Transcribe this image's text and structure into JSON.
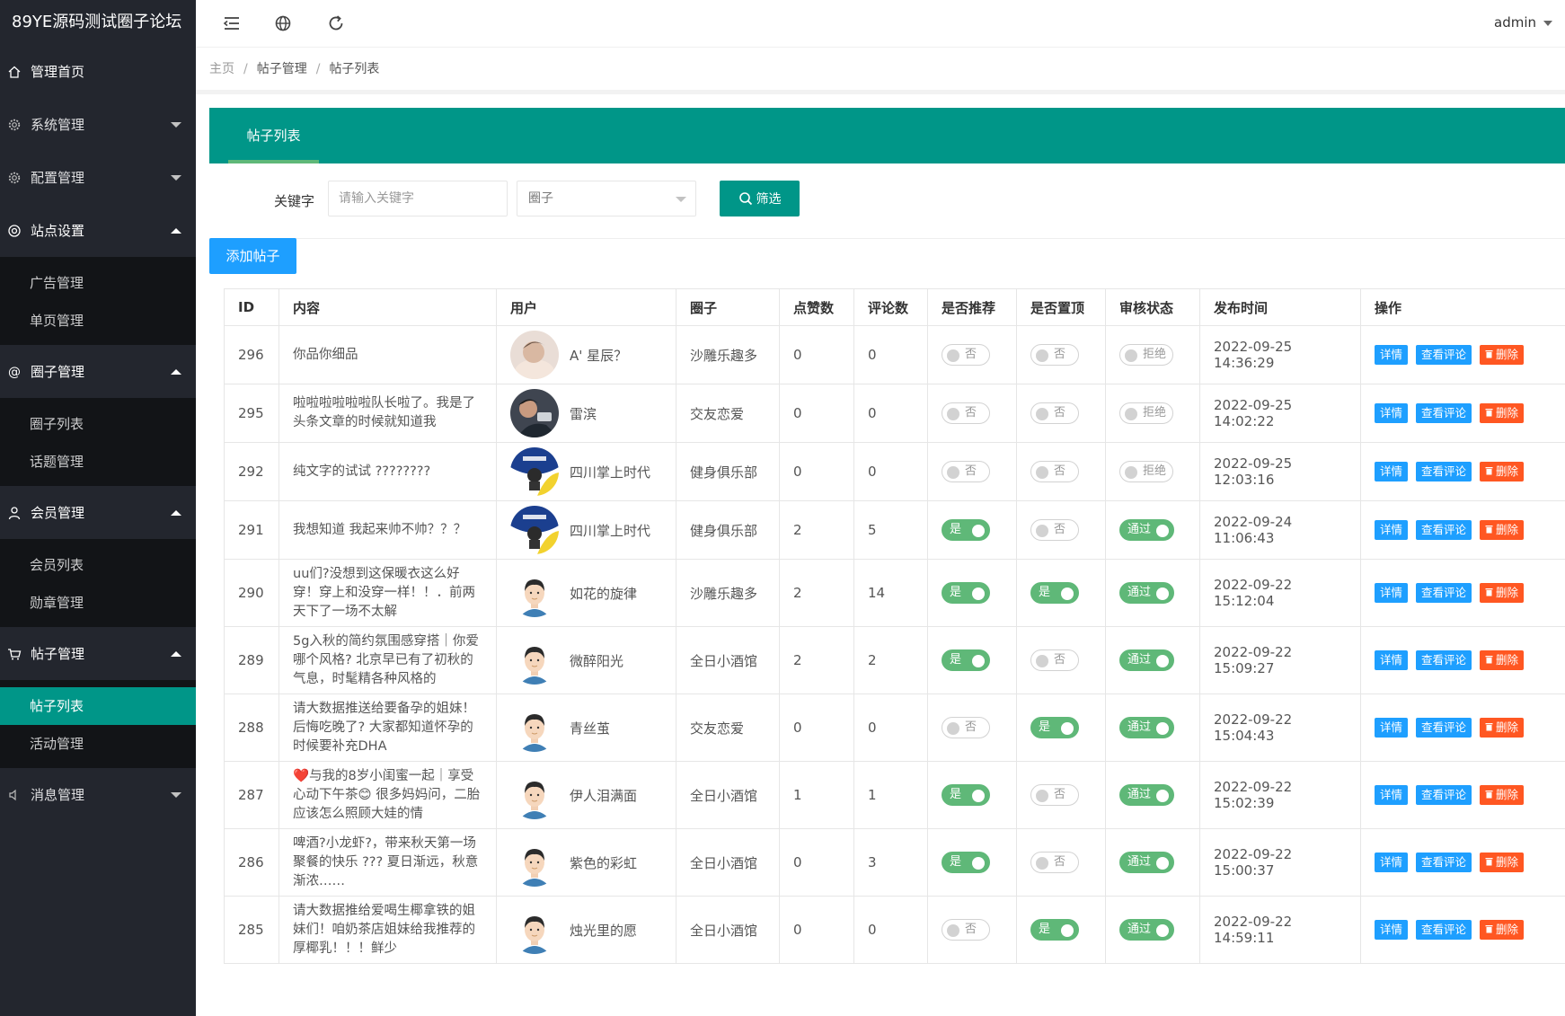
{
  "app": {
    "title": "89YE源码测试圈子论坛",
    "user": "admin"
  },
  "sidebar": {
    "items": [
      {
        "key": "home",
        "label": "管理首页",
        "icon": "home-icon",
        "arrow": ""
      },
      {
        "key": "system",
        "label": "系统管理",
        "icon": "gear-icon",
        "arrow": "down"
      },
      {
        "key": "config",
        "label": "配置管理",
        "icon": "gear-icon",
        "arrow": "down"
      },
      {
        "key": "site",
        "label": "站点设置",
        "icon": "target-icon",
        "arrow": "up",
        "children": [
          "广告管理",
          "单页管理"
        ]
      },
      {
        "key": "circle",
        "label": "圈子管理",
        "icon": "at-icon",
        "arrow": "up",
        "children": [
          "圈子列表",
          "话题管理"
        ]
      },
      {
        "key": "member",
        "label": "会员管理",
        "icon": "user-icon",
        "arrow": "up",
        "children": [
          "会员列表",
          "勋章管理"
        ]
      },
      {
        "key": "post",
        "label": "帖子管理",
        "icon": "cart-icon",
        "arrow": "up",
        "children": [
          "帖子列表",
          "活动管理"
        ],
        "active_child": 0
      },
      {
        "key": "message",
        "label": "消息管理",
        "icon": "speaker-icon",
        "arrow": "down"
      }
    ]
  },
  "header": {
    "icons": [
      "menu-fold-icon",
      "globe-icon",
      "refresh-icon"
    ]
  },
  "breadcrumb": [
    "主页",
    "帖子管理",
    "帖子列表"
  ],
  "tab": {
    "label": "帖子列表"
  },
  "filter": {
    "keyword_label": "关键字",
    "keyword_placeholder": "请输入关键字",
    "circle_placeholder": "圈子",
    "search_label": "筛选"
  },
  "add_button": "添加帖子",
  "table": {
    "headers": [
      "ID",
      "内容",
      "用户",
      "圈子",
      "点赞数",
      "评论数",
      "是否推荐",
      "是否置顶",
      "审核状态",
      "发布时间",
      "操作"
    ],
    "actions": {
      "detail": "详情",
      "comments": "查看评论",
      "delete": "删除"
    },
    "rows": [
      {
        "id": "296",
        "content": "你品你细品",
        "user": "A' 星辰？",
        "avatar": "photo-a",
        "circle": "沙雕乐趣多",
        "likes": "0",
        "comments": "0",
        "recommend": {
          "on": false,
          "label": "否"
        },
        "top": {
          "on": false,
          "label": "否"
        },
        "status": {
          "on": false,
          "label": "拒绝"
        },
        "time": "2022-09-25 14:36:29"
      },
      {
        "id": "295",
        "content": "啦啦啦啦啦啦队长啦了。我是了头条文章的时候就知道我",
        "user": "雷滨",
        "avatar": "photo-b",
        "circle": "交友恋爱",
        "likes": "0",
        "comments": "0",
        "recommend": {
          "on": false,
          "label": "否"
        },
        "top": {
          "on": false,
          "label": "否"
        },
        "status": {
          "on": false,
          "label": "拒绝"
        },
        "time": "2022-09-25 14:02:22"
      },
      {
        "id": "292",
        "content": "纯文字的试试 ????????",
        "user": "四川掌上时代",
        "avatar": "badge",
        "circle": "健身俱乐部",
        "likes": "0",
        "comments": "0",
        "recommend": {
          "on": false,
          "label": "否"
        },
        "top": {
          "on": false,
          "label": "否"
        },
        "status": {
          "on": false,
          "label": "拒绝"
        },
        "time": "2022-09-25 12:03:16"
      },
      {
        "id": "291",
        "content": "我想知道 我起来帅不帅？？？",
        "user": "四川掌上时代",
        "avatar": "badge",
        "circle": "健身俱乐部",
        "likes": "2",
        "comments": "5",
        "recommend": {
          "on": true,
          "label": "是"
        },
        "top": {
          "on": false,
          "label": "否"
        },
        "status": {
          "on": true,
          "label": "通过"
        },
        "time": "2022-09-24 11:06:43"
      },
      {
        "id": "290",
        "content": "uu们?没想到这保暖衣这么好穿！穿上和没穿一样！！．前两天下了一场不太解",
        "user": "如花的旋律",
        "avatar": "cartoon",
        "circle": "沙雕乐趣多",
        "likes": "2",
        "comments": "14",
        "recommend": {
          "on": true,
          "label": "是"
        },
        "top": {
          "on": true,
          "label": "是"
        },
        "status": {
          "on": true,
          "label": "通过"
        },
        "time": "2022-09-22 15:12:04"
      },
      {
        "id": "289",
        "content": "5g入秋的简约氛围感穿搭｜你爱哪个风格? 北京早已有了初秋的气息，时髦精各种风格的",
        "user": "微醉阳光",
        "avatar": "cartoon",
        "circle": "全日小酒馆",
        "likes": "2",
        "comments": "2",
        "recommend": {
          "on": true,
          "label": "是"
        },
        "top": {
          "on": false,
          "label": "否"
        },
        "status": {
          "on": true,
          "label": "通过"
        },
        "time": "2022-09-22 15:09:27"
      },
      {
        "id": "288",
        "content": "请大数据推送给要备孕的姐妹！后悔吃晚了? 大家都知道怀孕的时候要补充DHA",
        "user": "青丝茧",
        "avatar": "cartoon",
        "circle": "交友恋爱",
        "likes": "0",
        "comments": "0",
        "recommend": {
          "on": false,
          "label": "否"
        },
        "top": {
          "on": true,
          "label": "是"
        },
        "status": {
          "on": true,
          "label": "通过"
        },
        "time": "2022-09-22 15:04:43"
      },
      {
        "id": "287",
        "content": "❤️与我的8岁小闺蜜一起｜享受心动下午茶😊 很多妈妈问，二胎应该怎么照顾大娃的情",
        "user": "伊人泪满面",
        "avatar": "cartoon",
        "circle": "全日小酒馆",
        "likes": "1",
        "comments": "1",
        "recommend": {
          "on": true,
          "label": "是"
        },
        "top": {
          "on": false,
          "label": "否"
        },
        "status": {
          "on": true,
          "label": "通过"
        },
        "time": "2022-09-22 15:02:39"
      },
      {
        "id": "286",
        "content": "啤酒?小龙虾?，带来秋天第一场聚餐的快乐 ??? 夏日渐远，秋意渐浓……",
        "user": "紫色的彩虹",
        "avatar": "cartoon",
        "circle": "全日小酒馆",
        "likes": "0",
        "comments": "3",
        "recommend": {
          "on": true,
          "label": "是"
        },
        "top": {
          "on": false,
          "label": "否"
        },
        "status": {
          "on": true,
          "label": "通过"
        },
        "time": "2022-09-22 15:00:37"
      },
      {
        "id": "285",
        "content": "请大数据推给爱喝生椰拿铁的姐妹们！咱奶茶店姐妹给我推荐的厚椰乳！！！鲜少",
        "user": "烛光里的愿",
        "avatar": "cartoon",
        "circle": "全日小酒馆",
        "likes": "0",
        "comments": "0",
        "recommend": {
          "on": false,
          "label": "否"
        },
        "top": {
          "on": true,
          "label": "是"
        },
        "status": {
          "on": true,
          "label": "通过"
        },
        "time": "2022-09-22 14:59:11"
      }
    ]
  }
}
